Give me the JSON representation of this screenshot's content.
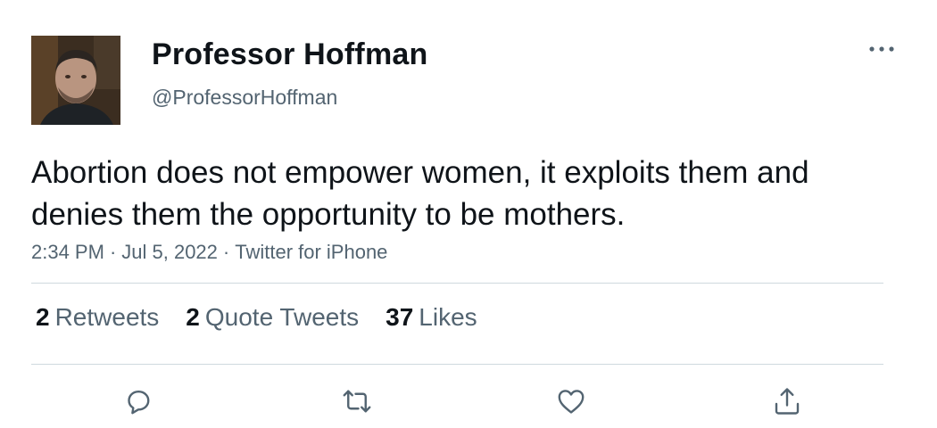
{
  "author": {
    "display_name": "Professor Hoffman",
    "handle": "@ProfessorHoffman",
    "avatar_icon": "profile-photo"
  },
  "header": {
    "more_icon": "more-horizontal-icon"
  },
  "tweet": {
    "text": "Abortion does not empower women, it exploits them and denies them the opportunity to be mothers.",
    "time": "2:34 PM",
    "date": "Jul 5, 2022",
    "source": "Twitter for iPhone",
    "separator": "·"
  },
  "stats": {
    "retweets": {
      "count": "2",
      "label": "Retweets"
    },
    "quote_tweets": {
      "count": "2",
      "label": "Quote Tweets"
    },
    "likes": {
      "count": "37",
      "label": "Likes"
    }
  },
  "actions": {
    "reply_icon": "reply-icon",
    "retweet_icon": "retweet-icon",
    "like_icon": "like-icon",
    "share_icon": "share-icon"
  },
  "colors": {
    "text_primary": "#0f1419",
    "text_secondary": "#536471",
    "divider": "#cfd9de"
  }
}
